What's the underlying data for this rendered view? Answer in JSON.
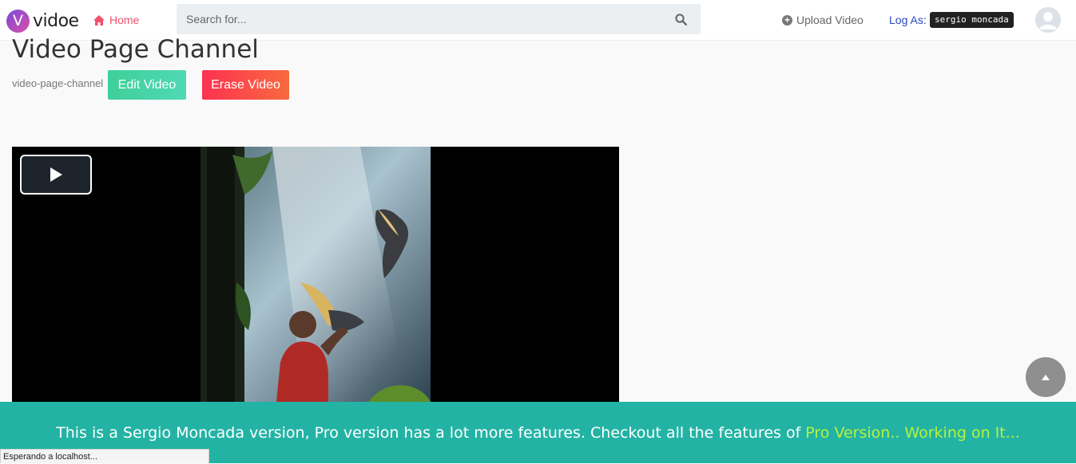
{
  "nav": {
    "logo_letter": "V",
    "logo_text": "vidoe",
    "home_label": "Home",
    "search_placeholder": "Search for...",
    "upload_label": "Upload Video",
    "log_as_label": "Log As:",
    "username": "sergio moncada"
  },
  "video": {
    "title": "Video Page Channel",
    "slug": "video-page-channel",
    "edit_label": "Edit Video",
    "erase_label": "Erase Video"
  },
  "footer": {
    "text": "This is a Sergio Moncada version, Pro version has a lot more features. Checkout all the features of",
    "pro_link": "Pro Version.. Working on It..."
  },
  "status_bar": "Esperando a localhost...",
  "colors": {
    "brand_pink": "#f0506e",
    "edit_green": "#4fd9b4",
    "erase_red": "#fe3151",
    "footer_teal": "#23b3a4",
    "pro_link": "#b6f23a"
  }
}
